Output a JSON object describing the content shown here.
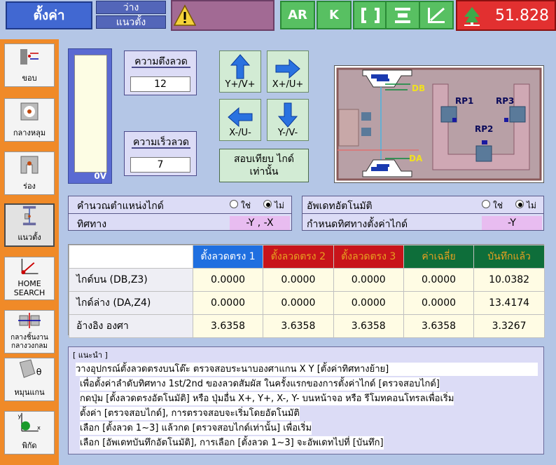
{
  "app": {
    "title": "ตั้งค่า",
    "status_top": "ว่าง",
    "status_bottom": "แนวตั้ง",
    "tool_labels": [
      "AR",
      "K"
    ],
    "value_display": "51.828"
  },
  "sidebar": {
    "items": [
      {
        "label": "ขอบ"
      },
      {
        "label": "กลางหลุม"
      },
      {
        "label": "ร่อง"
      },
      {
        "label": "แนวตั้ง"
      },
      {
        "label_line1": "HOME",
        "label_line2": "SEARCH"
      },
      {
        "label_line1": "กลางชิ้นงาน",
        "label_line2": "กลางวงกลม"
      },
      {
        "label": "หมุนแกน",
        "symbol": "θ"
      },
      {
        "label": "พิกัด",
        "axis_y": "y",
        "axis_x": "x"
      }
    ]
  },
  "gauge": {
    "value": "0V"
  },
  "tension": {
    "label": "ความตึงลวด",
    "value": "12"
  },
  "speed": {
    "label": "ความเร็วลวด",
    "value": "7"
  },
  "jog": {
    "up": "Y+/V+",
    "right": "X+/U+",
    "left": "X-/U-",
    "down": "Y-/V-"
  },
  "test_button": {
    "line1": "สอบเทียบ ไกด์",
    "line2": "เท่านั้น"
  },
  "diagram": {
    "db": "DB",
    "da": "DA",
    "rp1": "RP1",
    "rp2": "RP2",
    "rp3": "RP3"
  },
  "calc_guide": {
    "title": "คำนวณตำแหน่งไกด์",
    "yes": "ใช่",
    "no": "ไม่",
    "direction_label": "ทิศทาง",
    "direction_value": "-Y , -X"
  },
  "auto_update": {
    "title": "อัพเดทอัตโนมัติ",
    "yes": "ใช่",
    "no": "ไม่",
    "direction_label": "กำหนดทิศทางตั้งค่าไกด์",
    "direction_value": "-Y"
  },
  "table": {
    "headers": [
      "ตั้งลวดตรง 1",
      "ตั้งลวดตรง 2",
      "ตั้งลวดตรง 3",
      "ค่าเฉลี่ย",
      "บันทึกแล้ว"
    ],
    "rows": [
      {
        "label": "ไกด์บน (DB,Z3)",
        "values": [
          "0.0000",
          "0.0000",
          "0.0000",
          "0.0000",
          "10.0382"
        ]
      },
      {
        "label": "ไกด์ล่าง (DA,Z4)",
        "values": [
          "0.0000",
          "0.0000",
          "0.0000",
          "0.0000",
          "13.4174"
        ]
      },
      {
        "label": "อ้างอิง องศา",
        "values": [
          "3.6358",
          "3.6358",
          "3.6358",
          "3.6358",
          "3.3267"
        ]
      }
    ]
  },
  "hint": {
    "title": "[ แนะนำ ]",
    "lines": [
      "วางอุปกรณ์ตั้งลวดตรงบนโต๊ะ ตรวจสอบระนาบองศาแกน X Y [ตั้งค่าทิศทางย้าย]",
      "เพื่อตั้งค่าลำดับทิศทาง 1st/2nd ของลวดสัมผัส ในครั้งแรกของการตั้งค่าไกด์ [ตรวจสอบไกด์]",
      "กดปุ่ม [ตั้งลวดตรงอัตโนมัติ] หรือ ปุ่มอื่น X+, Y+, X-, Y- บนหน้าจอ หรือ รีโมทคอนโทรลเพื่อเริ่ม",
      "ตั้งค่า [ตรวจสอบไกด์], การตรวจสอบจะเริ่มโดยอัตโนมัติ",
      "เลือก [ตั้งลวด 1~3] แล้วกด [ตรวจสอบไกด์เท่านั้น] เพื่อเริ่ม",
      "เลือก [อัพเดทบันทึกอัตโนมัติ], การเลือก [ตั้งลวด 1~3] จะอัพเดทไปที่ [บันทึก]"
    ]
  },
  "colors": {
    "background": "#b4c6e6",
    "sidebar": "#f08a28",
    "header_blue": "#1f6fe0",
    "header_red": "#c8141a",
    "header_green": "#0e6e3a",
    "value_red": "#e23030"
  }
}
